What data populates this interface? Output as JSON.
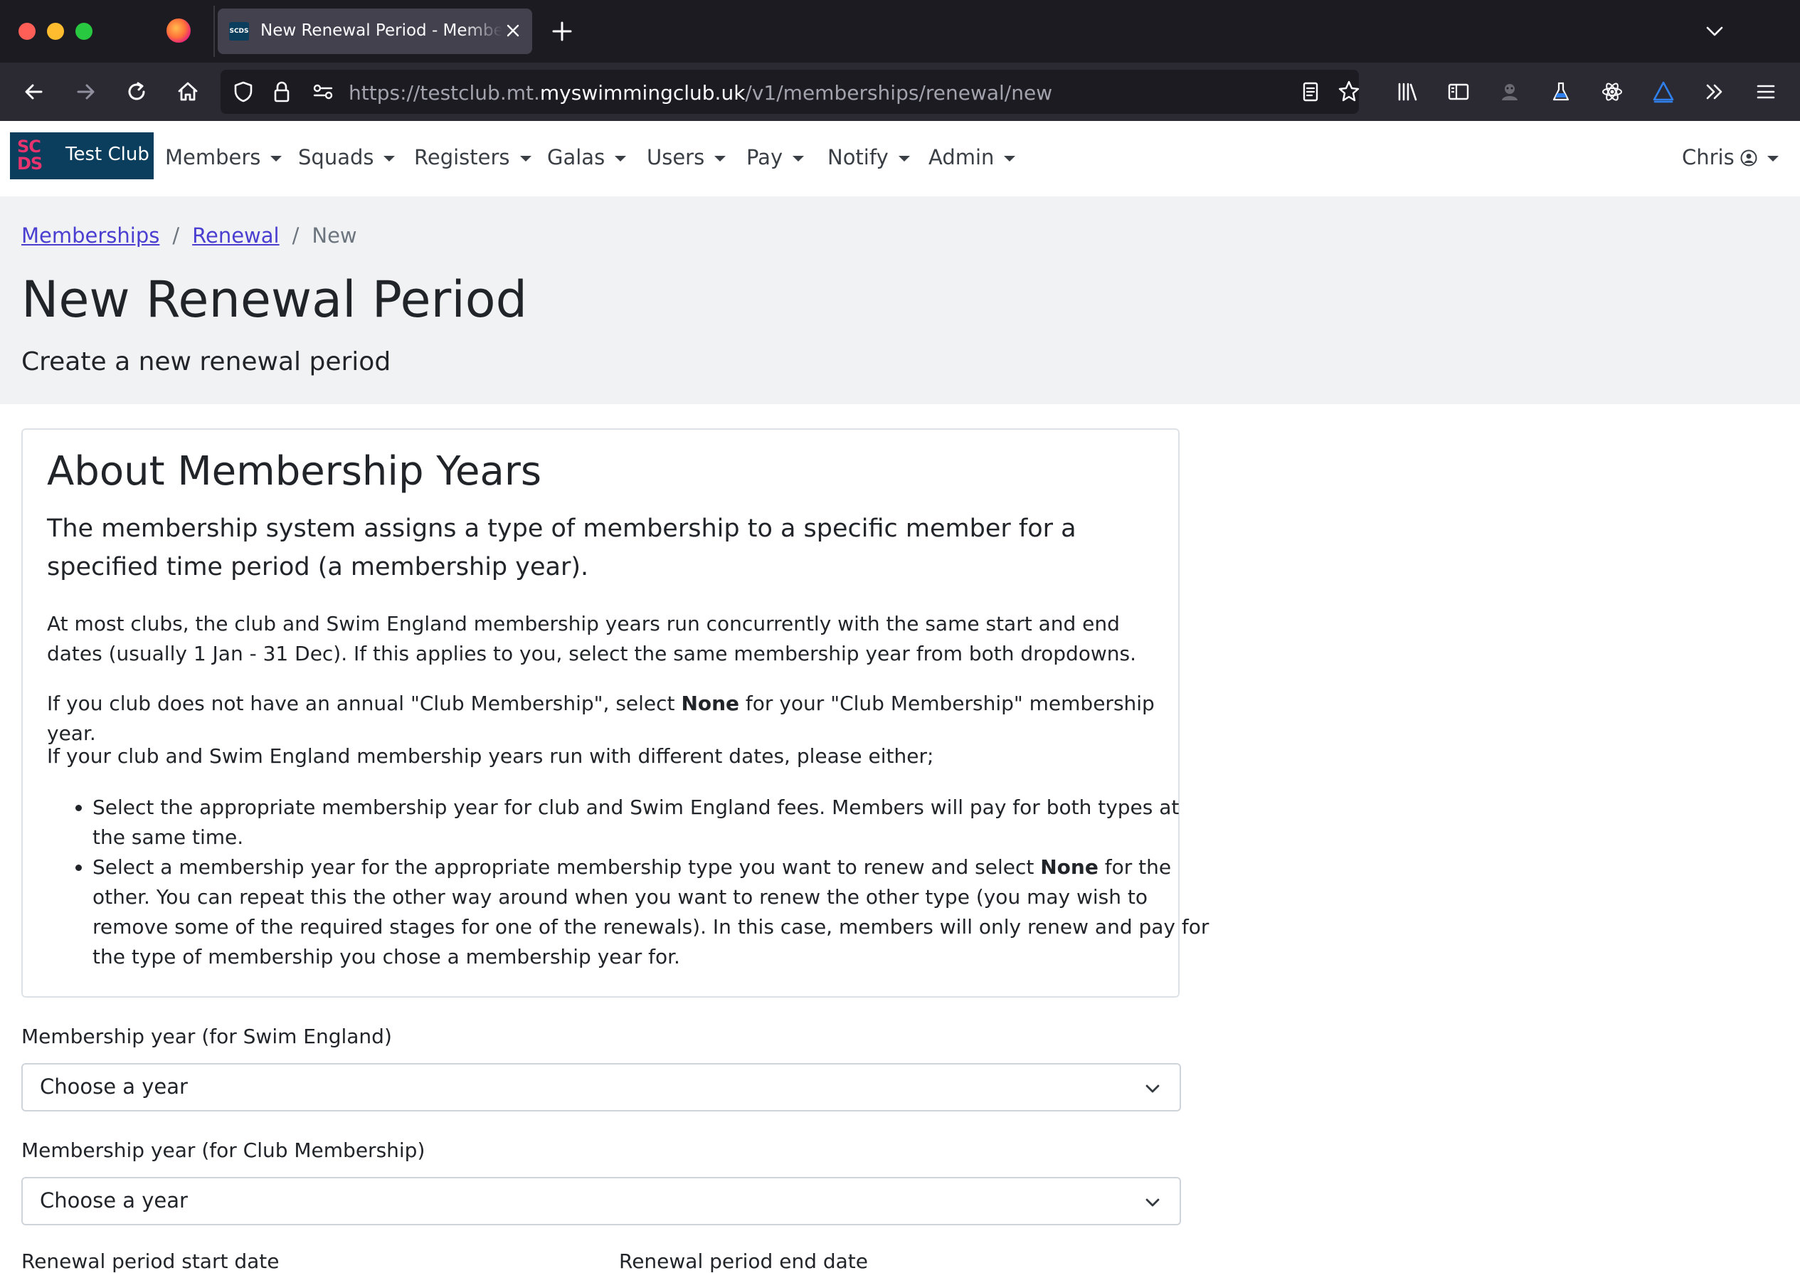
{
  "browser": {
    "tab_title": "New Renewal Period - Membership",
    "tab_favicon_text": "SCDS",
    "url_prefix": "https://testclub.mt.",
    "url_host": "myswimmingclub.uk",
    "url_path": "/v1/memberships/renewal/new"
  },
  "site": {
    "brand_logo_line1": "SC",
    "brand_logo_line2": "DS",
    "brand_name": "Test Club",
    "menu": [
      "Members",
      "Squads",
      "Registers",
      "Galas",
      "Users",
      "Pay",
      "Notify",
      "Admin"
    ],
    "user_name": "Chris",
    "brand_color": "#0b3d5c",
    "logo_accent": "#e8336e"
  },
  "breadcrumb": [
    "Memberships",
    "Renewal",
    "New"
  ],
  "page": {
    "title": "New Renewal Period",
    "subtitle": "Create a new renewal period"
  },
  "card": {
    "heading": "About Membership Years",
    "lead": "The membership system assigns a type of membership to a specific member for a specified time period (a membership year).",
    "para1": "At most clubs, the club and Swim England membership years run concurrently with the same start and end dates (usually 1 Jan - 31 Dec). If this applies to you, select the same membership year from both dropdowns.",
    "para2_a": "If you club does not have an annual \"Club Membership\", select ",
    "para2_b": "None",
    "para2_c": " for your \"Club Membership\" membership year.",
    "para3": "If your club and Swim England membership years run with different dates, please either;",
    "bullet1": "Select the appropriate membership year for club and Swim England fees. Members will pay for both types at the same time.",
    "bullet2_a": "Select a membership year for the appropriate membership type you want to renew and select ",
    "bullet2_b": "None",
    "bullet2_c": " for the other. You can repeat this the other way around when you want to renew the other type (you may wish to remove some of the required stages for one of the renewals). In this case, members will only renew and pay for the type of membership you chose a membership year for."
  },
  "form": {
    "se_label": "Membership year (for Swim England)",
    "se_value": "Choose a year",
    "club_label": "Membership year (for Club Membership)",
    "club_value": "Choose a year",
    "start_label": "Renewal period start date",
    "end_label": "Renewal period end date"
  }
}
